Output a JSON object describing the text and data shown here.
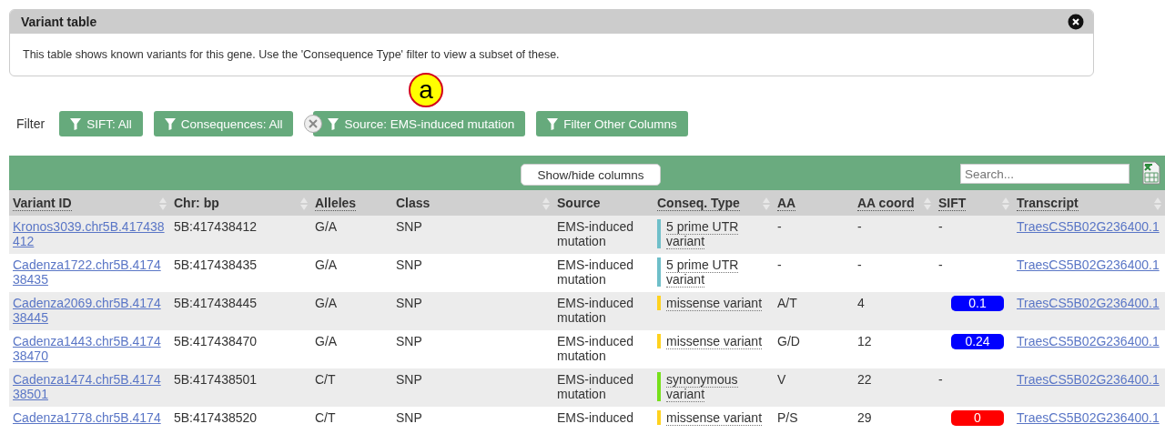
{
  "panel": {
    "title": "Variant table",
    "description": "This table shows known variants for this gene. Use the 'Consequence Type' filter to view a subset of these."
  },
  "annotation": {
    "label": "a"
  },
  "filter": {
    "label": "Filter",
    "buttons": [
      {
        "label": "SIFT: All",
        "removable": false
      },
      {
        "label": "Consequences: All",
        "removable": false
      },
      {
        "label": "Source: EMS-induced mutation",
        "removable": true
      },
      {
        "label": "Filter Other Columns",
        "removable": false
      }
    ]
  },
  "toolbar": {
    "columns_button": "Show/hide columns",
    "search": {
      "placeholder": "Search..."
    }
  },
  "table": {
    "columns": [
      {
        "label": "Variant ID",
        "sortable": true,
        "underlined": true
      },
      {
        "label": "Chr: bp",
        "sortable": true,
        "underlined": false
      },
      {
        "label": "Alleles",
        "sortable": false,
        "underlined": true
      },
      {
        "label": "Class",
        "sortable": true,
        "underlined": false
      },
      {
        "label": "Source",
        "sortable": false,
        "underlined": false
      },
      {
        "label": "Conseq. Type",
        "sortable": true,
        "underlined": true
      },
      {
        "label": "AA",
        "sortable": false,
        "underlined": true
      },
      {
        "label": "AA coord",
        "sortable": true,
        "underlined": true
      },
      {
        "label": "SIFT",
        "sortable": true,
        "underlined": true
      },
      {
        "label": "Transcript",
        "sortable": true,
        "underlined": true
      }
    ],
    "rows": [
      {
        "variant_id": "Kronos3039.chr5B.417438412",
        "chr_bp": "5B:417438412",
        "alleles": "G/A",
        "class": "SNP",
        "source": "EMS-induced mutation",
        "consequence": {
          "label": "5 prime UTR variant",
          "color": "#6fbfc9"
        },
        "aa": "-",
        "aa_coord": "-",
        "sift": {
          "kind": "text",
          "value": "-"
        },
        "transcript": "TraesCS5B02G236400.1"
      },
      {
        "variant_id": "Cadenza1722.chr5B.417438435",
        "chr_bp": "5B:417438435",
        "alleles": "G/A",
        "class": "SNP",
        "source": "EMS-induced mutation",
        "consequence": {
          "label": "5 prime UTR variant",
          "color": "#6fbfc9"
        },
        "aa": "-",
        "aa_coord": "-",
        "sift": {
          "kind": "text",
          "value": "-"
        },
        "transcript": "TraesCS5B02G236400.1"
      },
      {
        "variant_id": "Cadenza2069.chr5B.417438445",
        "chr_bp": "5B:417438445",
        "alleles": "G/A",
        "class": "SNP",
        "source": "EMS-induced mutation",
        "consequence": {
          "label": "missense variant",
          "color": "#ffd21f"
        },
        "aa": "A/T",
        "aa_coord": "4",
        "sift": {
          "kind": "badge",
          "value": "0.1",
          "color": "#0000ff"
        },
        "transcript": "TraesCS5B02G236400.1"
      },
      {
        "variant_id": "Cadenza1443.chr5B.417438470",
        "chr_bp": "5B:417438470",
        "alleles": "G/A",
        "class": "SNP",
        "source": "EMS-induced mutation",
        "consequence": {
          "label": "missense variant",
          "color": "#ffd21f"
        },
        "aa": "G/D",
        "aa_coord": "12",
        "sift": {
          "kind": "badge",
          "value": "0.24",
          "color": "#0000ff"
        },
        "transcript": "TraesCS5B02G236400.1"
      },
      {
        "variant_id": "Cadenza1474.chr5B.417438501",
        "chr_bp": "5B:417438501",
        "alleles": "C/T",
        "class": "SNP",
        "source": "EMS-induced mutation",
        "consequence": {
          "label": "synonymous variant",
          "color": "#76e01a"
        },
        "aa": "V",
        "aa_coord": "22",
        "sift": {
          "kind": "text",
          "value": "-"
        },
        "transcript": "TraesCS5B02G236400.1"
      },
      {
        "variant_id": "Cadenza1778.chr5B.4174",
        "chr_bp": "5B:417438520",
        "alleles": "C/T",
        "class": "SNP",
        "source": "EMS-induced",
        "consequence": {
          "label": "missense variant",
          "color": "#ffd21f"
        },
        "aa": "P/S",
        "aa_coord": "29",
        "sift": {
          "kind": "badge",
          "value": "0",
          "color": "#ff0000"
        },
        "transcript": "TraesCS5B02G236400.1"
      }
    ]
  }
}
